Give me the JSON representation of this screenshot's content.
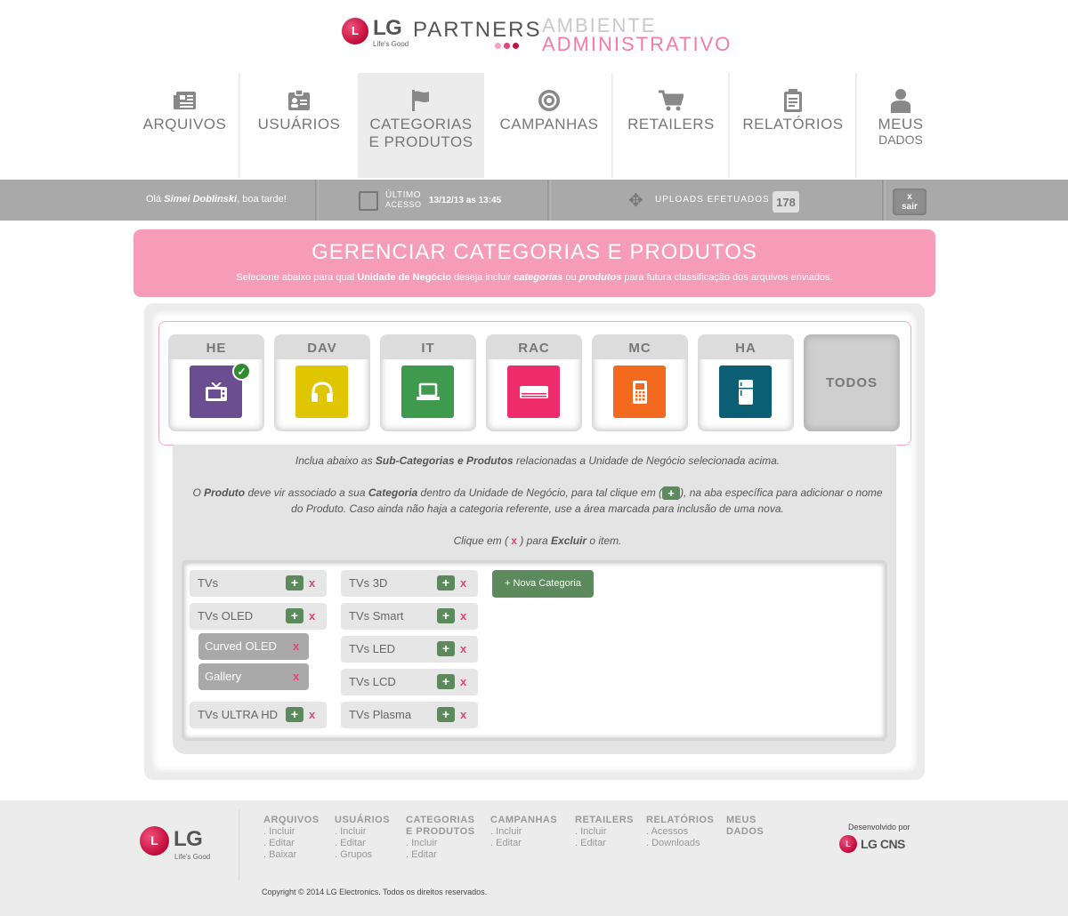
{
  "brand": {
    "logo": "LG",
    "tagline": "Life's Good",
    "partners": "PARTNERS",
    "title_line1": "AMBIENTE",
    "title_line2": "ADMINISTRATIVO"
  },
  "nav": [
    {
      "label": "ARQUIVOS",
      "icon": "newspaper-icon"
    },
    {
      "label": "USUÁRIOS",
      "icon": "id-card-icon"
    },
    {
      "label": "CATEGORIAS",
      "label2": "E PRODUTOS",
      "icon": "flag-icon",
      "active": true
    },
    {
      "label": "CAMPANHAS",
      "icon": "target-icon"
    },
    {
      "label": "RETAILERS",
      "icon": "cart-icon"
    },
    {
      "label": "RELATÓRIOS",
      "icon": "clipboard-icon"
    },
    {
      "label": "MEUS",
      "sub": "DADOS",
      "icon": "user-icon"
    }
  ],
  "status": {
    "greeting_pre": "Olá ",
    "user": "Simei Doblinski",
    "greeting_post": ", boa tarde!",
    "last_label1": "ÚLTIMO",
    "last_label2": "ACESSO",
    "last_date": "13/12/13 as 13:45",
    "uploads_label": "UPLOADS EFETUADOS",
    "uploads_count": "178",
    "logout_x": "x",
    "logout_label": "sair"
  },
  "banner": {
    "title": "GERENCIAR CATEGORIAS E PRODUTOS",
    "desc_1": "Selecione abaixo para qual ",
    "desc_b1": "Unidade de Negócio",
    "desc_2": " deseja incluir ",
    "desc_b2": "categorias",
    "desc_3": " ou ",
    "desc_b3": "produtos",
    "desc_4": " para futura classificação dos arquivos enviados."
  },
  "units": [
    {
      "code": "HE",
      "color": "#6b4d91",
      "icon": "tv-icon",
      "selected": true
    },
    {
      "code": "DAV",
      "color": "#e0c600",
      "icon": "headphones-icon"
    },
    {
      "code": "IT",
      "color": "#3f9a4d",
      "icon": "laptop-icon"
    },
    {
      "code": "RAC",
      "color": "#ef2c6b",
      "icon": "air-conditioner-icon"
    },
    {
      "code": "MC",
      "color": "#f36a1f",
      "icon": "phone-icon"
    },
    {
      "code": "HA",
      "color": "#0b5e74",
      "icon": "fridge-icon"
    }
  ],
  "units_all": "TODOS",
  "instructions": {
    "l1_a": "Inclua abaixo as ",
    "l1_b": "Sub-Categorias e Produtos",
    "l1_c": " relacionadas a Unidade de Negócio selecionada acima.",
    "l2_a": "O ",
    "l2_b": "Produto",
    "l2_c": " deve vir associado a sua ",
    "l2_d": "Categoria",
    "l2_e": " dentro da Unidade de Negócio, para tal clique em (",
    "l2_f": "), na aba específica para adicionar o nome do Produto. Caso ainda não haja a categoria referente, use a área marcada para inclusão de uma nova.",
    "l3_a": "Clique em (",
    "l3_b": ") para ",
    "l3_c": "Excluir",
    "l3_d": " o item.",
    "plus": "+",
    "x": "x"
  },
  "categories_col1": [
    "TVs",
    "TVs OLED",
    "TVs ULTRA HD"
  ],
  "subitems": [
    "Curved OLED",
    "Gallery"
  ],
  "categories_col2": [
    "TVs 3D",
    "TVs Smart",
    "TVs LED",
    "TVs LCD",
    "TVs Plasma"
  ],
  "new_category": "+ Nova Categoria",
  "footer": {
    "cols": [
      {
        "head": "ARQUIVOS",
        "items": [
          ". Incluir",
          ". Editar",
          ". Baixar"
        ]
      },
      {
        "head": "USUÁRIOS",
        "items": [
          ". Incluir",
          ". Editar",
          ". Grupos"
        ]
      },
      {
        "head": "CATEGORIAS",
        "head2": "E PRODUTOS",
        "items": [
          ". Incluir",
          ". Editar"
        ]
      },
      {
        "head": "CAMPANHAS",
        "items": [
          ". Incluir",
          ". Editar"
        ]
      },
      {
        "head": "RETAILERS",
        "items": [
          ". Incluir",
          ". Editar"
        ]
      },
      {
        "head": "RELATÓRIOS",
        "items": [
          ". Acessos",
          ". Downloads"
        ]
      },
      {
        "head": "MEUS",
        "head2": "DADOS",
        "items": []
      }
    ],
    "developed_by": "Desenvolvido por",
    "cns": "LG CNS",
    "copyright": "Copyright © 2014 LG Electronics. Todos os direitos reservados."
  }
}
